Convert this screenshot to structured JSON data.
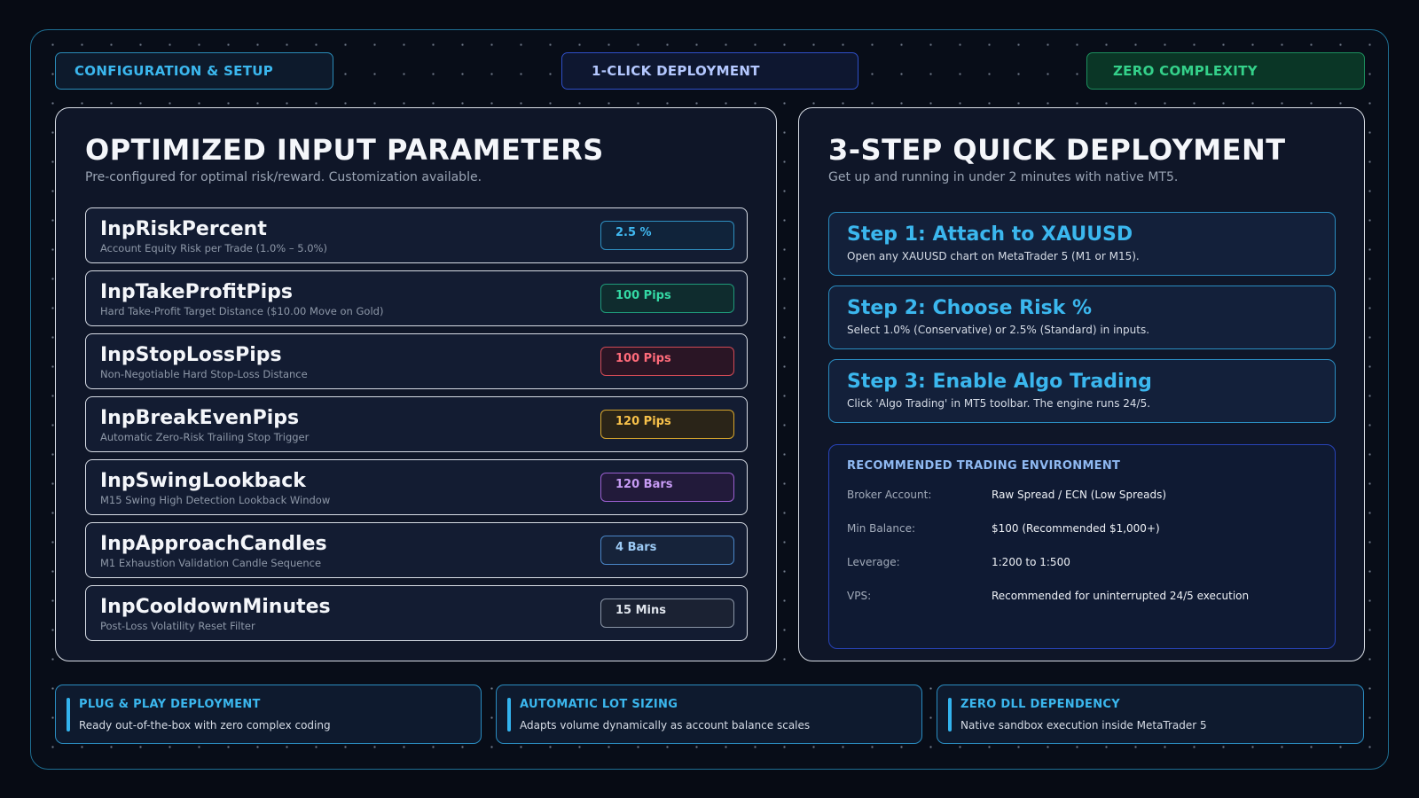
{
  "header": {
    "configuration_label": "CONFIGURATION & SETUP",
    "deployment_label": "1-CLICK DEPLOYMENT",
    "complexity_label": "ZERO COMPLEXITY"
  },
  "parameters_panel": {
    "title": "OPTIMIZED INPUT PARAMETERS",
    "subtitle": "Pre-configured for optimal risk/reward. Customization available.",
    "items": [
      {
        "name": "InpRiskPercent",
        "description": "Account Equity Risk per Trade (1.0% – 5.0%)",
        "value": "2.5 %"
      },
      {
        "name": "InpTakeProfitPips",
        "description": "Hard Take-Profit Target Distance ($10.00 Move on Gold)",
        "value": "100 Pips"
      },
      {
        "name": "InpStopLossPips",
        "description": "Non-Negotiable Hard Stop-Loss Distance",
        "value": "100 Pips"
      },
      {
        "name": "InpBreakEvenPips",
        "description": "Automatic Zero-Risk Trailing Stop Trigger",
        "value": "120 Pips"
      },
      {
        "name": "InpSwingLookback",
        "description": "M15 Swing High Detection Lookback Window",
        "value": "120 Bars"
      },
      {
        "name": "InpApproachCandles",
        "description": "M1 Exhaustion Validation Candle Sequence",
        "value": "4 Bars"
      },
      {
        "name": "InpCooldownMinutes",
        "description": "Post-Loss Volatility Reset Filter",
        "value": "15 Mins"
      }
    ],
    "value_colors": [
      "#40b8f0",
      "#34d8a4",
      "#ff6b7a",
      "#f7c14a",
      "#c79bf4",
      "#9ccaf5",
      "#dfe4ec"
    ]
  },
  "deployment_panel": {
    "title": "3-STEP QUICK DEPLOYMENT",
    "subtitle": "Get up and running in under 2 minutes with native MT5.",
    "steps": [
      {
        "title": "Step 1: Attach to XAUUSD",
        "description": "Open any XAUUSD chart on MetaTrader 5 (M1 or M15)."
      },
      {
        "title": "Step 2: Choose Risk %",
        "description": "Select 1.0% (Conservative) or 2.5% (Standard) in inputs."
      },
      {
        "title": "Step 3: Enable Algo Trading",
        "description": "Click 'Algo Trading' in MT5 toolbar. The engine runs 24/5."
      }
    ],
    "environment": {
      "title": "RECOMMENDED TRADING ENVIRONMENT",
      "rows": [
        {
          "label": "Broker Account:",
          "value": "Raw Spread / ECN (Low Spreads)"
        },
        {
          "label": "Min Balance:",
          "value": "$100 (Recommended $1,000+)"
        },
        {
          "label": "Leverage:",
          "value": "1:200 to 1:500"
        },
        {
          "label": "VPS:",
          "value": "Recommended for uninterrupted 24/5 execution"
        }
      ]
    }
  },
  "features": [
    {
      "title": "PLUG & PLAY DEPLOYMENT",
      "description": "Ready out-of-the-box with zero complex coding"
    },
    {
      "title": "AUTOMATIC LOT SIZING",
      "description": "Adapts volume dynamically as account balance scales"
    },
    {
      "title": "ZERO DLL DEPENDENCY",
      "description": "Native sandbox execution inside MetaTrader 5"
    }
  ],
  "colors": {
    "accent": "#3bb7ee",
    "success": "#34d18a",
    "background": "#070b14",
    "panel": "#0f1628"
  }
}
